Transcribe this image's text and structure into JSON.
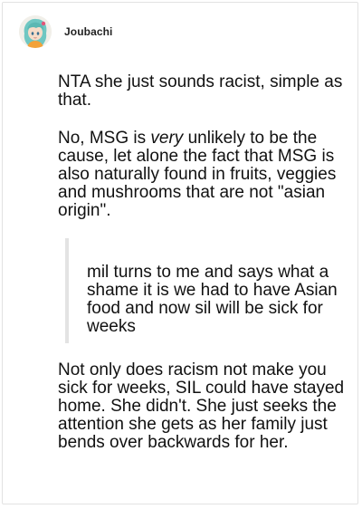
{
  "post": {
    "username": "Joubachi",
    "avatar_icon": "anime-character-avatar-icon",
    "paragraph1": "NTA she just sounds racist, simple as that.",
    "paragraph2_part1": "No, MSG is ",
    "paragraph2_emphasis": "very",
    "paragraph2_part2": " unlikely to be the cause, let alone the fact that MSG is also naturally found in fruits, veggies and mushrooms that are not \"asian origin\".",
    "quote": "mil turns to me and says what a shame it is we had to have Asian food and now sil will be sick for weeks",
    "paragraph3": "Not only does racism not make you sick for weeks, SIL could have stayed home. She didn't. She just seeks the attention she gets as her family just bends over backwards for her."
  },
  "colors": {
    "card_border": "#e2e2e2",
    "quote_bar": "#e3e3e3",
    "text": "#111111",
    "avatar_hair": "#6fc7c2"
  }
}
